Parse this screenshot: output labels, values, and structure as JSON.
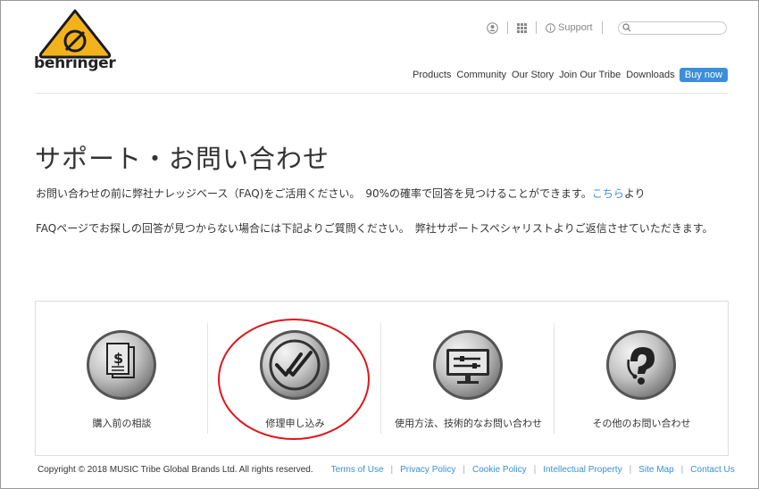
{
  "brand": {
    "name": "behringer",
    "accent": "#f2b21b"
  },
  "utility": {
    "support_label": "Support",
    "search_placeholder": ""
  },
  "nav": {
    "items": [
      "Products",
      "Community",
      "Our Story",
      "Join Our Tribe",
      "Downloads"
    ],
    "buy_label": "Buy now",
    "buy_color": "#3b8fd9"
  },
  "page": {
    "title": "サポート・お問い合わせ",
    "intro_before": "お問い合わせの前に弊社ナレッジベース（FAQ)をご活用ください。　90%の確率で回答を見つけることができます。",
    "intro_link": "こちら",
    "intro_after": "より",
    "notice": "FAQページでお探しの回答が見つからない場合には下記よりご質問ください。　弊社サポートスペシャリストよりご返信させていただきます。"
  },
  "cards": [
    {
      "label": "購入前の相談",
      "icon": "price-document-icon"
    },
    {
      "label": "修理申し込み",
      "icon": "double-check-icon"
    },
    {
      "label": "使用方法、技術的なお問い合わせ",
      "icon": "monitor-tools-icon"
    },
    {
      "label": "その他のお問い合わせ",
      "icon": "question-headset-icon"
    }
  ],
  "highlight_color": "#e0151b",
  "footer": {
    "copyright": "Copyright © 2018 MUSIC Tribe Global Brands Ltd. All rights reserved.",
    "links": [
      "Terms of Use",
      "Privacy Policy",
      "Cookie Policy",
      "Intellectual Property",
      "Site Map",
      "Contact Us"
    ]
  }
}
